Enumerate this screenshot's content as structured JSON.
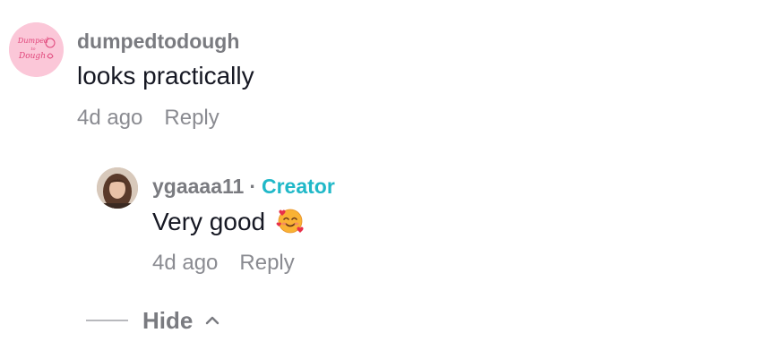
{
  "comment": {
    "username": "dumpedtodough",
    "text": "looks practically",
    "time": "4d ago",
    "reply_label": "Reply",
    "avatar_logo_text": "Dumped to Dough"
  },
  "reply": {
    "username": "ygaaaa11",
    "separator": "·",
    "badge": "Creator",
    "text": "Very good",
    "emoji_icon": "smiling-face-with-hearts-icon",
    "time": "4d ago",
    "reply_label": "Reply"
  },
  "thread": {
    "hide_label": "Hide"
  },
  "colors": {
    "creator_badge": "#20b8c8",
    "username": "#7a7b80",
    "meta": "#8a8b91",
    "brand_avatar_bg": "#fbc7d8"
  }
}
